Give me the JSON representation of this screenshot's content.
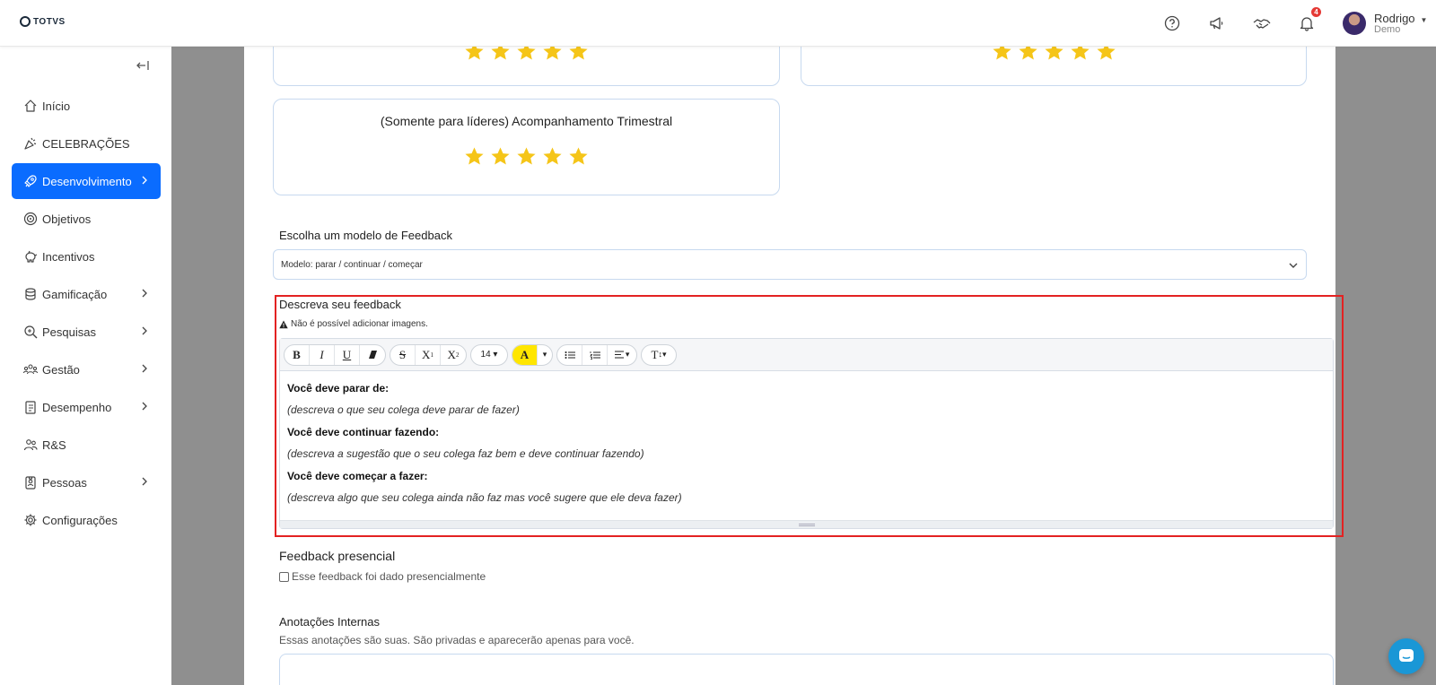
{
  "brand": {
    "logo_text": "TOTVS"
  },
  "header": {
    "notifications_count": "4",
    "user": {
      "name": "Rodrigo",
      "role": "Demo"
    }
  },
  "sidebar": {
    "items": [
      {
        "label": "Início",
        "icon": "home-icon",
        "submenu": false
      },
      {
        "label": "CELEBRAÇÕES",
        "icon": "party-icon",
        "submenu": false
      },
      {
        "label": "Desenvolvimento",
        "icon": "rocket-icon",
        "submenu": true,
        "active": true
      },
      {
        "label": "Objetivos",
        "icon": "target-icon",
        "submenu": false
      },
      {
        "label": "Incentivos",
        "icon": "piggy-bank-icon",
        "submenu": false
      },
      {
        "label": "Gamificação",
        "icon": "coins-icon",
        "submenu": true
      },
      {
        "label": "Pesquisas",
        "icon": "search-icon",
        "submenu": true
      },
      {
        "label": "Gestão",
        "icon": "team-icon",
        "submenu": true
      },
      {
        "label": "Desempenho",
        "icon": "clipboard-icon",
        "submenu": true
      },
      {
        "label": "R&S",
        "icon": "people-icon",
        "submenu": false
      },
      {
        "label": "Pessoas",
        "icon": "badge-icon",
        "submenu": true
      },
      {
        "label": "Configurações",
        "icon": "gear-icon",
        "submenu": false
      }
    ]
  },
  "cards": {
    "top_left_rating": 5,
    "top_right_rating": 5,
    "trimestral": {
      "title": "(Somente para líderes) Acompanhamento Trimestral",
      "rating": 5
    }
  },
  "model": {
    "label": "Escolha um modelo de Feedback",
    "selected": "Modelo: parar / continuar / começar"
  },
  "feedback": {
    "label": "Descreva seu feedback",
    "warning": "Não é possível adicionar imagens.",
    "toolbar": {
      "bold": "B",
      "italic": "I",
      "underline": "U",
      "strike": "S",
      "superscript": "X",
      "subscript": "X",
      "font_size": "14",
      "color": "A",
      "text_style": "T"
    },
    "content": [
      {
        "heading": "Você deve parar de:",
        "hint": "(descreva o que seu colega deve parar de fazer)"
      },
      {
        "heading": "Você deve continuar fazendo:",
        "hint": "(descreva a sugestão que o seu colega faz bem e deve continuar fazendo)"
      },
      {
        "heading": "Você deve começar a fazer:",
        "hint": "(descreva algo que seu colega ainda não faz mas você sugere que ele deva fazer)"
      }
    ]
  },
  "presencial": {
    "title": "Feedback presencial",
    "checkbox_label": "Esse feedback foi dado presencialmente",
    "checked": false
  },
  "notes": {
    "title": "Anotações Internas",
    "subtitle": "Essas anotações são suas. São privadas e aparecerão apenas para você.",
    "value": ""
  },
  "colors": {
    "accent": "#0a6cff",
    "star": "#f5c518",
    "highlight": "#e32222",
    "backdrop": "#8f8f8f"
  }
}
